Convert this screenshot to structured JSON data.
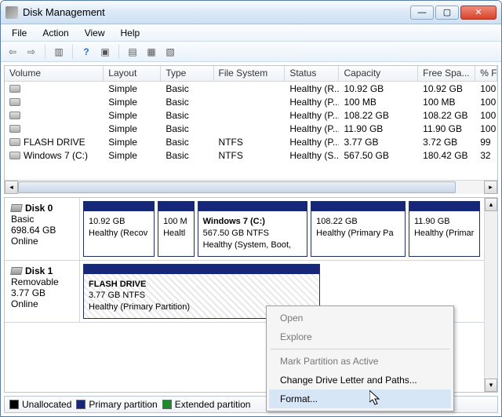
{
  "window": {
    "title": "Disk Management"
  },
  "menubar": [
    "File",
    "Action",
    "View",
    "Help"
  ],
  "columns": [
    "Volume",
    "Layout",
    "Type",
    "File System",
    "Status",
    "Capacity",
    "Free Spa...",
    "% F"
  ],
  "volumes": [
    {
      "name": "",
      "layout": "Simple",
      "type": "Basic",
      "fs": "",
      "status": "Healthy (R...",
      "capacity": "10.92 GB",
      "free": "10.92 GB",
      "pct": "100"
    },
    {
      "name": "",
      "layout": "Simple",
      "type": "Basic",
      "fs": "",
      "status": "Healthy (P...",
      "capacity": "100 MB",
      "free": "100 MB",
      "pct": "100"
    },
    {
      "name": "",
      "layout": "Simple",
      "type": "Basic",
      "fs": "",
      "status": "Healthy (P...",
      "capacity": "108.22 GB",
      "free": "108.22 GB",
      "pct": "100"
    },
    {
      "name": "",
      "layout": "Simple",
      "type": "Basic",
      "fs": "",
      "status": "Healthy (P...",
      "capacity": "11.90 GB",
      "free": "11.90 GB",
      "pct": "100"
    },
    {
      "name": "FLASH DRIVE",
      "layout": "Simple",
      "type": "Basic",
      "fs": "NTFS",
      "status": "Healthy (P...",
      "capacity": "3.77 GB",
      "free": "3.72 GB",
      "pct": "99"
    },
    {
      "name": "Windows 7 (C:)",
      "layout": "Simple",
      "type": "Basic",
      "fs": "NTFS",
      "status": "Healthy (S...",
      "capacity": "567.50 GB",
      "free": "180.42 GB",
      "pct": "32"
    }
  ],
  "disks": [
    {
      "name": "Disk 0",
      "type": "Basic",
      "size": "698.64 GB",
      "status": "Online",
      "partitions": [
        {
          "title": "",
          "line1": "10.92 GB",
          "line2": "Healthy (Recov",
          "flex": 18
        },
        {
          "title": "",
          "line1": "100 M",
          "line2": "Healtl",
          "flex": 9
        },
        {
          "title": "Windows 7  (C:)",
          "line1": "567.50 GB NTFS",
          "line2": "Healthy (System, Boot,",
          "flex": 28
        },
        {
          "title": "",
          "line1": "108.22 GB",
          "line2": "Healthy (Primary Pa",
          "flex": 24
        },
        {
          "title": "",
          "line1": "11.90 GB",
          "line2": "Healthy (Primar",
          "flex": 18
        }
      ]
    },
    {
      "name": "Disk 1",
      "type": "Removable",
      "size": "3.77 GB",
      "status": "Online",
      "partitions": [
        {
          "title": "FLASH DRIVE",
          "line1": "3.77 GB NTFS",
          "line2": "Healthy (Primary Partition)",
          "flex": 60,
          "hatched": true
        }
      ]
    }
  ],
  "legend": [
    {
      "label": "Unallocated",
      "color": "#000000"
    },
    {
      "label": "Primary partition",
      "color": "#16277a"
    },
    {
      "label": "Extended partition",
      "color": "#1a8a2b"
    }
  ],
  "context_menu": {
    "items": [
      {
        "label": "Open",
        "enabled": false
      },
      {
        "label": "Explore",
        "enabled": false
      },
      {
        "sep": true
      },
      {
        "label": "Mark Partition as Active",
        "enabled": false
      },
      {
        "label": "Change Drive Letter and Paths...",
        "enabled": true
      },
      {
        "label": "Format...",
        "enabled": true,
        "highlight": true
      }
    ]
  }
}
